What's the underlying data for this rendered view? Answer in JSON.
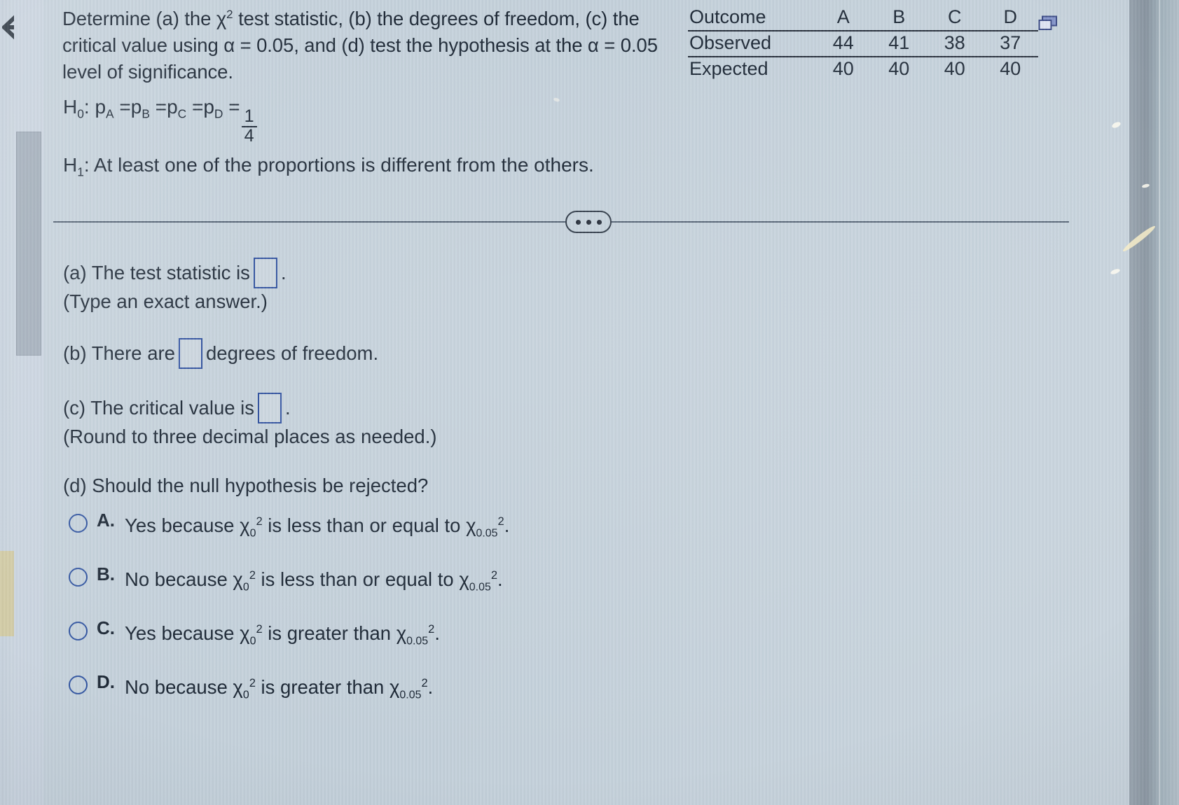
{
  "left_rail": {
    "back_icon": "back-arrow-icon",
    "scroll_up_icon": "scroll-up-arrow-icon",
    "scroll_down_icon": "scroll-down-arrow-icon",
    "scroll_thumb": "scrollbar-thumb"
  },
  "prompt": {
    "part1": "Determine (a) the ",
    "chi": "χ",
    "sup2": "2",
    "part2": " test statistic, (b) the degrees of freedom, (c) the critical value using α = 0.05, and (d) test the hypothesis at the α = 0.05 level of significance.",
    "alpha_value": "0.05"
  },
  "table": {
    "popup_icon": "open-in-new-window-icon",
    "headers": [
      "Outcome",
      "A",
      "B",
      "C",
      "D"
    ],
    "rows": [
      {
        "label": "Observed",
        "values": [
          "44",
          "41",
          "38",
          "37"
        ]
      },
      {
        "label": "Expected",
        "values": [
          "40",
          "40",
          "40",
          "40"
        ]
      }
    ]
  },
  "hypotheses": {
    "h0_label": "H",
    "h0_sub": "0",
    "h0_colon": ": ",
    "h0_body": "p",
    "h0_expr_subs": [
      "A",
      "B",
      "C",
      "D"
    ],
    "h0_numerator": "1",
    "h0_denominator": "4",
    "h1_label": "H",
    "h1_sub": "1",
    "h1_text": ": At least one of the proportions is different from the others."
  },
  "divider": {
    "more_label": "…",
    "dots": 3
  },
  "answers": {
    "a_text_before": "(a) The test statistic is",
    "a_text_after": ".",
    "a_note": "(Type an exact answer.)",
    "a_value": "",
    "a_placeholder": "",
    "b_text_before": "(b) There are",
    "b_text_after": "degrees of freedom.",
    "b_value": "",
    "b_placeholder": "",
    "c_text_before": "(c) The critical value is",
    "c_text_after": ".",
    "c_note": "(Round to three decimal places as needed.)",
    "c_value": "",
    "c_placeholder": "",
    "d_text": "(d) Should the null hypothesis be rejected?"
  },
  "choices": [
    {
      "letter": "A.",
      "lead": "Yes because ",
      "chi": "χ",
      "sup": "2",
      "sub": "0",
      "middle": " is less than or equal to ",
      "chi2": "χ",
      "sup2": "2",
      "sub2": "0.05",
      "tail": ".",
      "selected": false
    },
    {
      "letter": "B.",
      "lead": "No because ",
      "chi": "χ",
      "sup": "2",
      "sub": "0",
      "middle": " is less than or equal to ",
      "chi2": "χ",
      "sup2": "2",
      "sub2": "0.05",
      "tail": ".",
      "selected": false
    },
    {
      "letter": "C.",
      "lead": "Yes because ",
      "chi": "χ",
      "sup": "2",
      "sub": "0",
      "middle": " is greater than ",
      "chi2": "χ",
      "sup2": "2",
      "sub2": "0.05",
      "tail": ".",
      "selected": false
    },
    {
      "letter": "D.",
      "lead": "No because ",
      "chi": "χ",
      "sup": "2",
      "sub": "0",
      "middle": " is greater than ",
      "chi2": "χ",
      "sup2": "2",
      "sub2": "0.05",
      "tail": ".",
      "selected": false
    }
  ],
  "colors": {
    "page_background": "#c3d0da",
    "text": "#14202e",
    "input_border": "#24479a",
    "radio_border": "#2a4f9e",
    "rule": "#1b2330",
    "highlight_patch": "#cfc79a"
  }
}
